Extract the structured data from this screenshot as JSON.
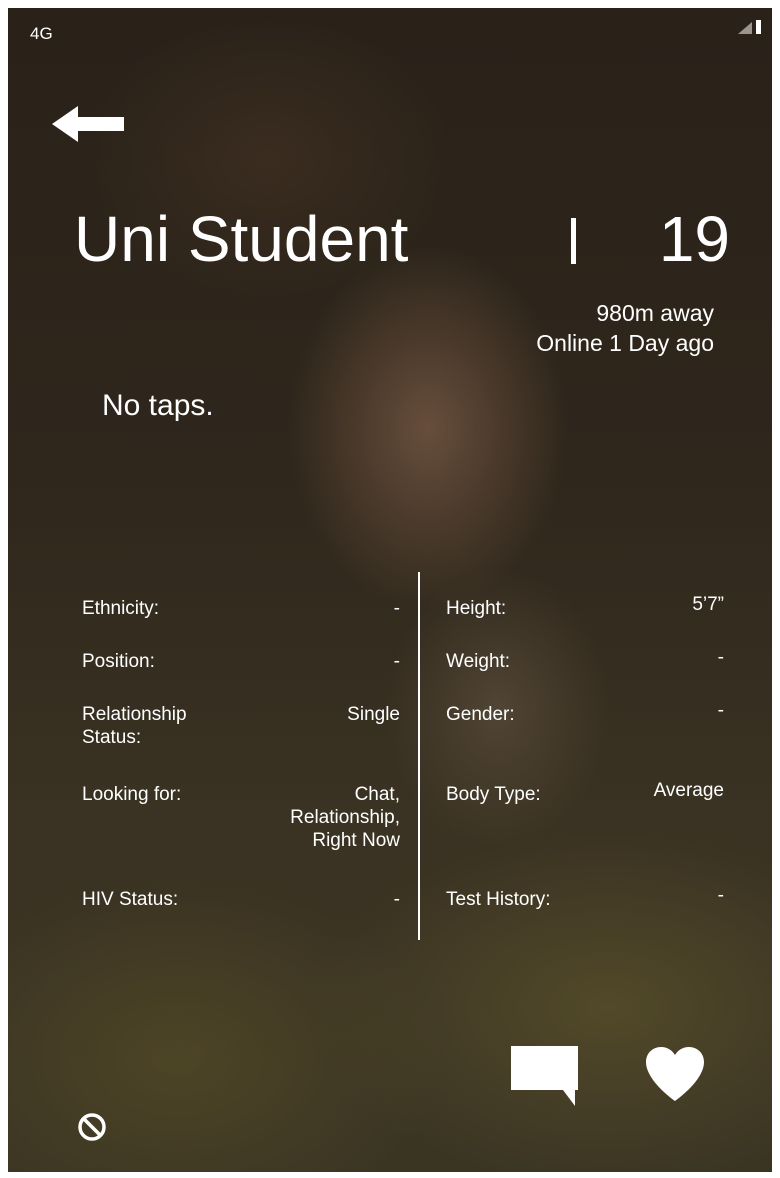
{
  "status_bar": {
    "carrier": "4G"
  },
  "profile": {
    "name": "Uni Student",
    "age": "19",
    "distance": "980m away",
    "last_online": "Online 1 Day ago",
    "taps": "No taps."
  },
  "details": {
    "left": [
      {
        "label": "Ethnicity:",
        "value": "-"
      },
      {
        "label": "Position:",
        "value": "-"
      },
      {
        "label_lines": [
          "Relationship",
          "Status:"
        ],
        "value": "Single"
      },
      {
        "label": "Looking for:",
        "value_lines": [
          "Chat,",
          "Relationship,",
          "Right Now"
        ]
      },
      {
        "label": "HIV Status:",
        "value": "-"
      }
    ],
    "right": [
      {
        "label": "Height:",
        "value": "5’7”"
      },
      {
        "label": "Weight:",
        "value": "-"
      },
      {
        "label": "Gender:",
        "value": "-"
      },
      {
        "label": "Body Type:",
        "value": "Average"
      },
      {
        "label": "Test History:",
        "value": "-"
      }
    ]
  },
  "icons": {
    "back": "arrow-left-icon",
    "chat": "chat-bubble-icon",
    "favorite": "heart-icon",
    "block": "block-icon"
  }
}
